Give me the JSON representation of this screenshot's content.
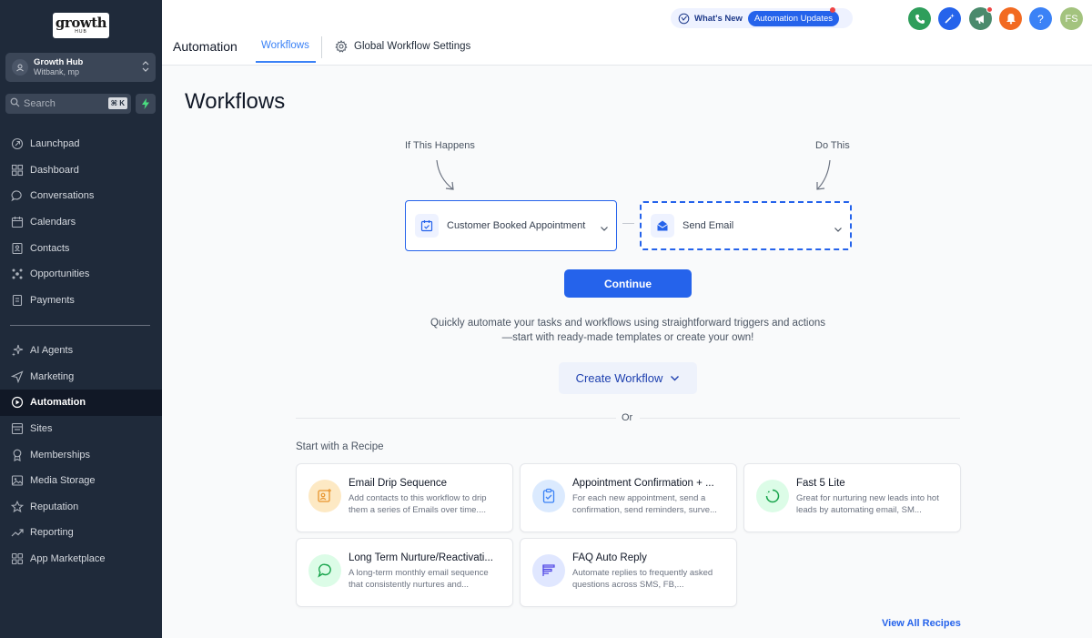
{
  "logo": {
    "main": "growth",
    "sub": "HUB"
  },
  "account": {
    "name": "Growth Hub",
    "location": "Witbank, mp"
  },
  "search": {
    "placeholder": "Search",
    "shortcut": "⌘ K"
  },
  "sidebar": {
    "items": [
      {
        "label": "Launchpad",
        "icon": "rocket-icon"
      },
      {
        "label": "Dashboard",
        "icon": "dashboard-icon"
      },
      {
        "label": "Conversations",
        "icon": "chat-icon"
      },
      {
        "label": "Calendars",
        "icon": "calendar-icon"
      },
      {
        "label": "Contacts",
        "icon": "contacts-icon"
      },
      {
        "label": "Opportunities",
        "icon": "opportunities-icon"
      },
      {
        "label": "Payments",
        "icon": "payments-icon"
      }
    ],
    "items2": [
      {
        "label": "AI Agents",
        "icon": "sparkle-icon"
      },
      {
        "label": "Marketing",
        "icon": "send-icon"
      },
      {
        "label": "Automation",
        "icon": "automation-icon",
        "active": true
      },
      {
        "label": "Sites",
        "icon": "sites-icon"
      },
      {
        "label": "Memberships",
        "icon": "membership-icon"
      },
      {
        "label": "Media Storage",
        "icon": "image-icon"
      },
      {
        "label": "Reputation",
        "icon": "star-icon"
      },
      {
        "label": "Reporting",
        "icon": "trend-icon"
      },
      {
        "label": "App Marketplace",
        "icon": "grid-icon"
      }
    ]
  },
  "header": {
    "title": "Automation",
    "tab_workflows": "Workflows",
    "tab_settings": "Global Workflow Settings",
    "whats_new": "What's New",
    "automation_updates": "Automation Updates",
    "avatar_initials": "FS",
    "help": "?"
  },
  "colors": {
    "accent": "#2563eb",
    "sidebar_bg": "#1f2a3a",
    "phone": "#2e9e5b",
    "megaphone": "#4a8a6c",
    "bell": "#f26a21",
    "help": "#3b82f6",
    "avatar": "#a3c37e"
  },
  "main": {
    "title": "Workflows",
    "if_label": "If This Happens",
    "do_label": "Do This",
    "trigger": "Customer Booked Appointment",
    "action": "Send Email",
    "continue": "Continue",
    "description": "Quickly automate your tasks and workflows using straightforward triggers and actions—start with ready-made templates or create your own!",
    "create_workflow": "Create Workflow",
    "or": "Or",
    "recipe_heading": "Start with a Recipe",
    "view_all": "View All Recipes"
  },
  "recipes": [
    {
      "title": "Email Drip Sequence",
      "desc": "Add contacts to this workflow to drip them a series of Emails over time....",
      "icon": "email-drip-icon",
      "bg": "#fde9c4",
      "fg": "#e8942e"
    },
    {
      "title": "Appointment Confirmation + ...",
      "desc": "For each new appointment, send a confirmation, send reminders, surve...",
      "icon": "clipboard-check-icon",
      "bg": "#dbeafe",
      "fg": "#3b82f6"
    },
    {
      "title": "Fast 5 Lite",
      "desc": "Great for nurturing new leads into hot leads by automating email, SM...",
      "icon": "progress-circle-icon",
      "bg": "#dcfce7",
      "fg": "#16a34a"
    },
    {
      "title": "Long Term Nurture/Reactivati...",
      "desc": "A long-term monthly email sequence that consistently nurtures and...",
      "icon": "message-bubble-icon",
      "bg": "#dcfce7",
      "fg": "#16a34a"
    },
    {
      "title": "FAQ Auto Reply",
      "desc": "Automate replies to frequently asked questions across SMS, FB,...",
      "icon": "list-reply-icon",
      "bg": "#e0e7ff",
      "fg": "#4f46e5"
    }
  ]
}
